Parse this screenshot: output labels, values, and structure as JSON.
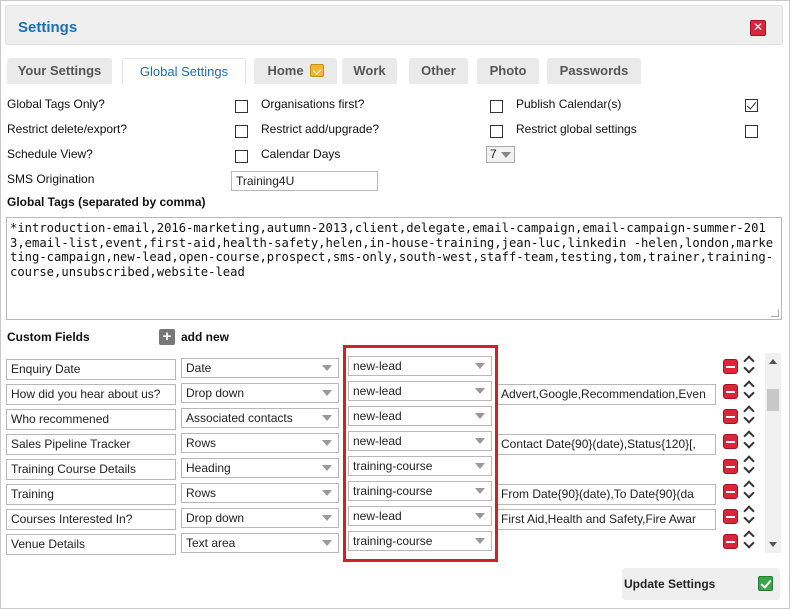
{
  "window": {
    "title": "Settings",
    "close_icon": "close-icon"
  },
  "tabs": [
    {
      "label": "Your Settings",
      "active": false
    },
    {
      "label": "Global Settings",
      "active": true
    },
    {
      "label": "Home",
      "active": false,
      "icon": "edit-badge-icon"
    },
    {
      "label": "Work",
      "active": false
    },
    {
      "label": "Other",
      "active": false
    },
    {
      "label": "Photo",
      "active": false
    },
    {
      "label": "Passwords",
      "active": false
    }
  ],
  "options": {
    "global_tags_only": {
      "label": "Global Tags Only?",
      "checked": false
    },
    "organisations_first": {
      "label": "Organisations first?",
      "checked": false
    },
    "publish_calendar": {
      "label": "Publish Calendar(s)",
      "checked": true
    },
    "restrict_delete_export": {
      "label": "Restrict delete/export?",
      "checked": false
    },
    "restrict_add_upgrade": {
      "label": "Restrict add/upgrade?",
      "checked": false
    },
    "restrict_global_settings": {
      "label": "Restrict global settings",
      "checked": false
    },
    "schedule_view": {
      "label": "Schedule View?",
      "checked": false
    },
    "calendar_days": {
      "label": "Calendar Days",
      "value": "7"
    },
    "sms_origination": {
      "label": "SMS Origination",
      "value": "Training4U"
    }
  },
  "global_tags": {
    "label": "Global Tags (separated by comma)",
    "value": "*introduction-email,2016-marketing,autumn-2013,client,delegate,email-campaign,email-campaign-summer-2013,email-list,event,first-aid,health-safety,helen,in-house-training,jean-luc,linkedin -helen,london,marketing-campaign,new-lead,open-course,prospect,sms-only,south-west,staff-team,testing,tom,trainer,training-course,unsubscribed,website-lead"
  },
  "custom_fields": {
    "label": "Custom Fields",
    "add_new_label": "add new",
    "rows": [
      {
        "name": "Enquiry Date",
        "type": "Date",
        "tag": "new-lead",
        "options": ""
      },
      {
        "name": "How did you hear about us?",
        "type": "Drop down",
        "tag": "new-lead",
        "options": "Advert,Google,Recommendation,Even"
      },
      {
        "name": "Who recommened",
        "type": "Associated contacts",
        "tag": "new-lead",
        "options": ""
      },
      {
        "name": "Sales Pipeline Tracker",
        "type": "Rows",
        "tag": "new-lead",
        "options": "Contact Date{90}(date),Status{120}[,"
      },
      {
        "name": "Training Course Details",
        "type": "Heading",
        "tag": "training-course",
        "options": ""
      },
      {
        "name": "Training",
        "type": "Rows",
        "tag": "training-course",
        "options": "From Date{90}(date),To Date{90}(da"
      },
      {
        "name": "Courses Interested In?",
        "type": "Drop down",
        "tag": "new-lead",
        "options": "First Aid,Health and Safety,Fire Awar"
      },
      {
        "name": "Venue Details",
        "type": "Text area",
        "tag": "training-course",
        "options": ""
      }
    ]
  },
  "footer": {
    "update_label": "Update Settings"
  },
  "colors": {
    "title_blue": "#1a6fb5",
    "highlight_red": "#d41f2b",
    "delete_red": "#d9263a",
    "confirm_green": "#3aa64a"
  }
}
